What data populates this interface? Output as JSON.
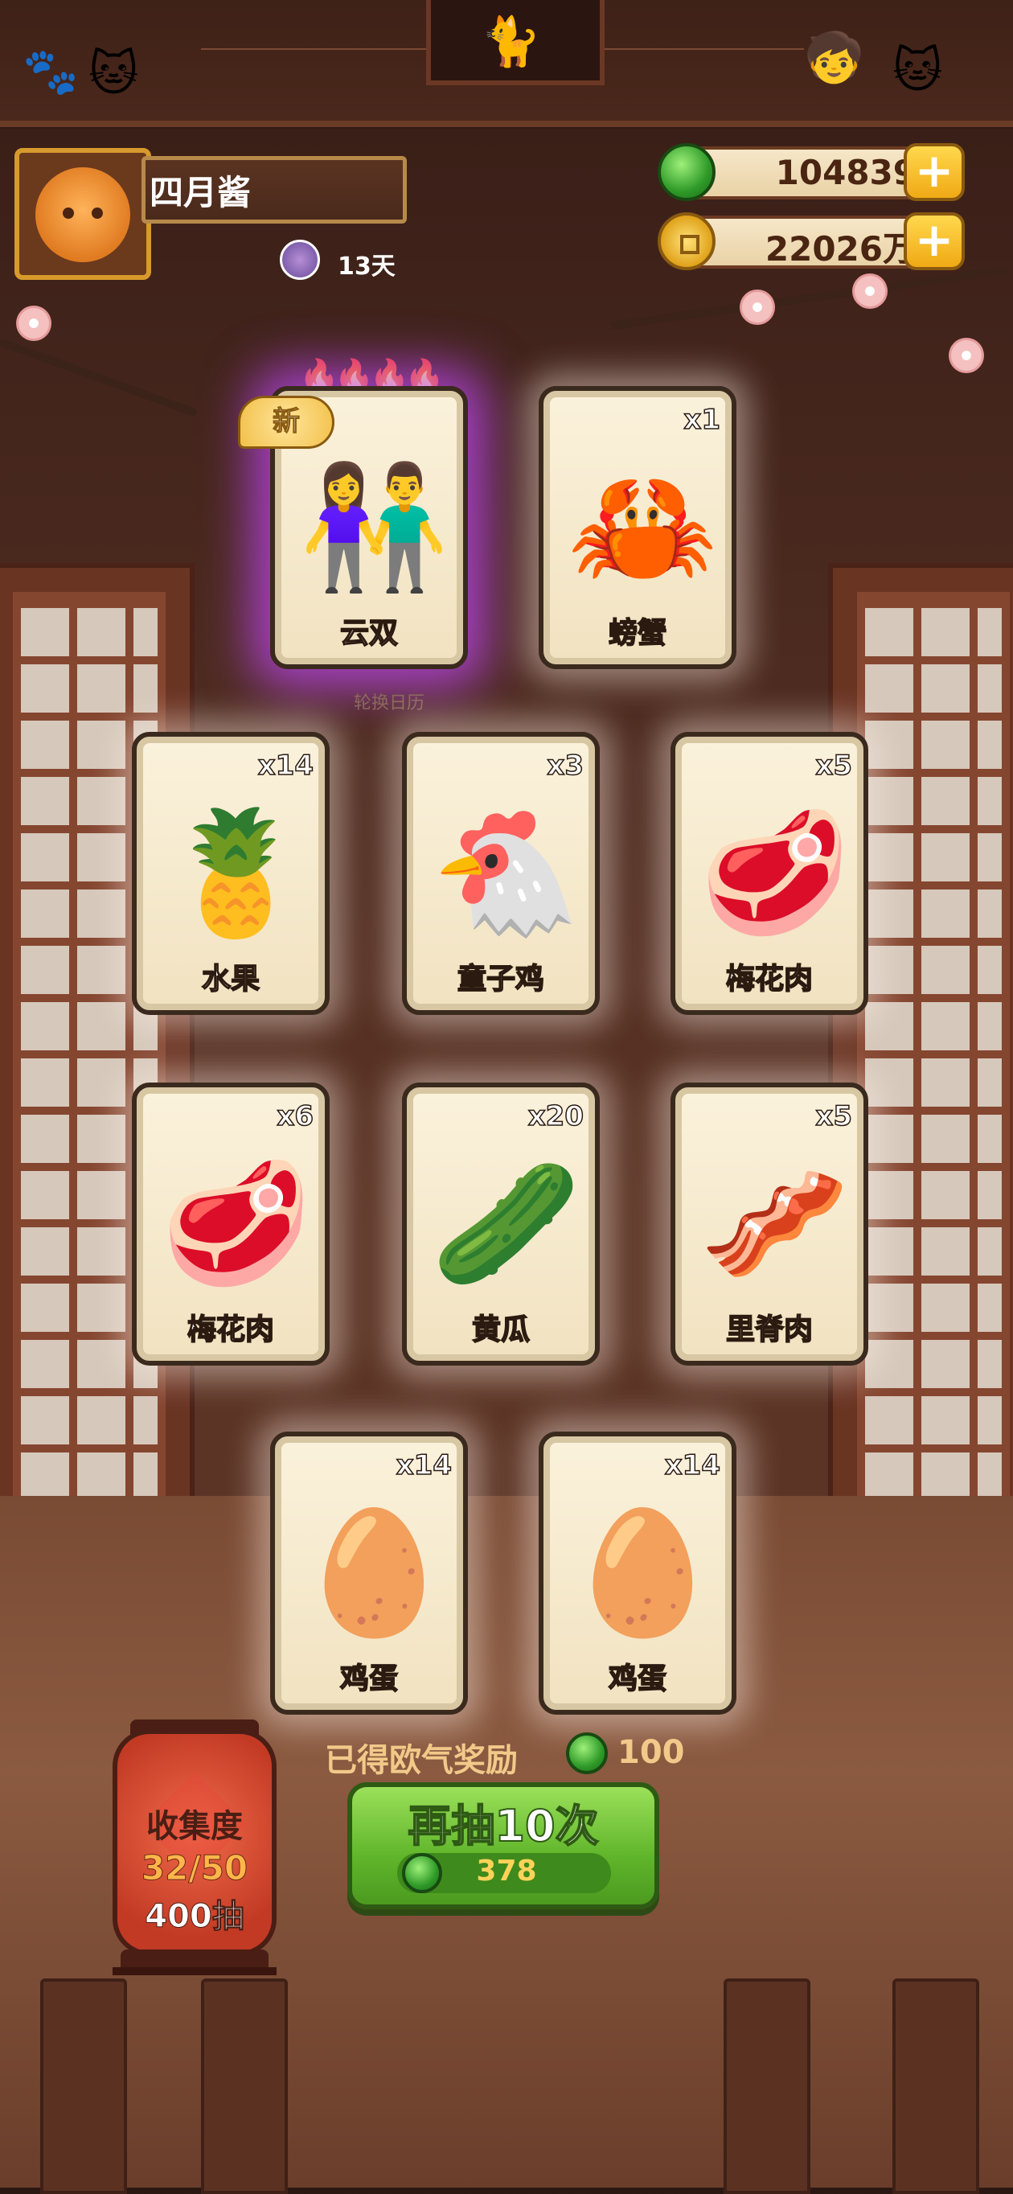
{
  "profile": {
    "name": "四月酱",
    "days": "13天"
  },
  "currency": {
    "jade": "104839",
    "coins": "22026万"
  },
  "calendar_label": "轮换日历",
  "new_badge": "新",
  "cards": [
    {
      "name": "云双",
      "count": "",
      "icon": "character-duo-icon",
      "rare": true,
      "emoji": "👫"
    },
    {
      "name": "螃蟹",
      "count": "x1",
      "icon": "crab-icon",
      "rare": false,
      "emoji": "🦀"
    },
    {
      "name": "水果",
      "count": "x14",
      "icon": "fruit-icon",
      "rare": false,
      "emoji": "🍍"
    },
    {
      "name": "童子鸡",
      "count": "x3",
      "icon": "chicken-icon",
      "rare": false,
      "emoji": "🐔"
    },
    {
      "name": "梅花肉",
      "count": "x5",
      "icon": "pork-icon",
      "rare": false,
      "emoji": "🥩"
    },
    {
      "name": "梅花肉",
      "count": "x6",
      "icon": "pork-icon",
      "rare": false,
      "emoji": "🥩"
    },
    {
      "name": "黄瓜",
      "count": "x20",
      "icon": "cucumber-icon",
      "rare": false,
      "emoji": "🥒"
    },
    {
      "name": "里脊肉",
      "count": "x5",
      "icon": "tenderloin-icon",
      "rare": false,
      "emoji": "🥓"
    },
    {
      "name": "鸡蛋",
      "count": "x14",
      "icon": "egg-icon",
      "rare": false,
      "emoji": "🥚"
    },
    {
      "name": "鸡蛋",
      "count": "x14",
      "icon": "egg-icon",
      "rare": false,
      "emoji": "🥚"
    }
  ],
  "reward": {
    "label": "已得欧气奖励",
    "value": "100"
  },
  "draw": {
    "label": "再抽10次",
    "cost": "378"
  },
  "collection": {
    "title": "收集度",
    "ratio": "32/50",
    "pulls": "400抽"
  }
}
